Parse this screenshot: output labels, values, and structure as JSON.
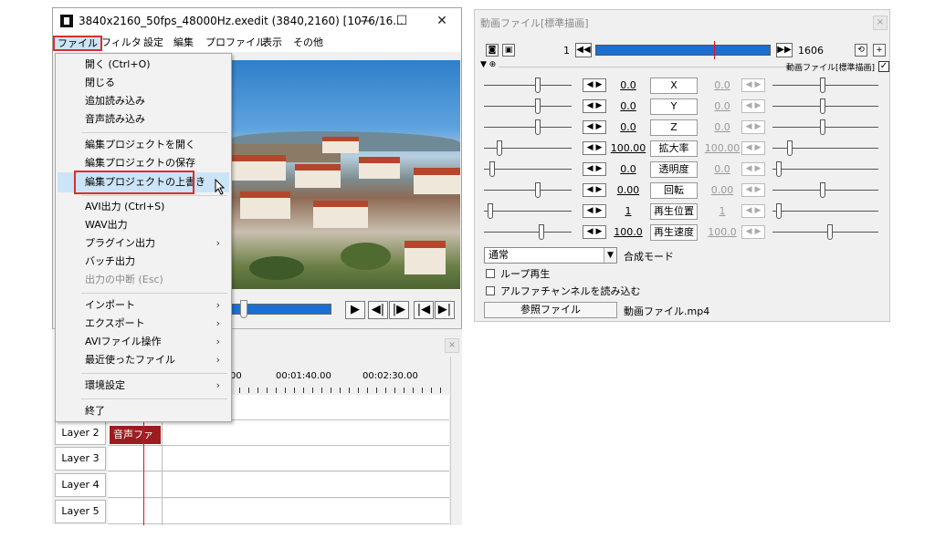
{
  "main_window": {
    "title": "3840x2160_50fps_48000Hz.exedit (3840,2160)  [1076/16...",
    "controls": {
      "minimize": "—",
      "maximize": "☐",
      "close": "✕"
    },
    "menubar": [
      "ファイル",
      "フィルタ",
      "設定",
      "編集",
      "プロファイル",
      "表示",
      "その他"
    ]
  },
  "file_menu": {
    "items": [
      {
        "label": "開く (Ctrl+O)"
      },
      {
        "label": "閉じる"
      },
      {
        "label": "追加読み込み"
      },
      {
        "label": "音声読み込み"
      },
      {
        "label": "編集プロジェクトを開く"
      },
      {
        "label": "編集プロジェクトの保存"
      },
      {
        "label": "編集プロジェクトの上書き"
      },
      {
        "label": "AVI出力 (Ctrl+S)"
      },
      {
        "label": "WAV出力"
      },
      {
        "label": "プラグイン出力",
        "arrow": "›"
      },
      {
        "label": "バッチ出力"
      },
      {
        "label": "出力の中断 (Esc)"
      },
      {
        "label": "インポート",
        "arrow": "›"
      },
      {
        "label": "エクスポート",
        "arrow": "›"
      },
      {
        "label": "AVIファイル操作",
        "arrow": "›"
      },
      {
        "label": "最近使ったファイル",
        "arrow": "›"
      },
      {
        "label": "環境設定",
        "arrow": "›"
      },
      {
        "label": "終了"
      }
    ],
    "highlighted_item": "編集プロジェクトの上書き"
  },
  "transport": {
    "buttons": [
      "▶",
      "◀|",
      "|▶",
      "|◀",
      "▶|"
    ]
  },
  "timeline": {
    "close": "×",
    "ruler_labels": [
      "00",
      "00:01:40.00",
      "00:02:30.00"
    ],
    "layers": [
      "Layer 2",
      "Layer 3",
      "Layer 4",
      "Layer 5"
    ],
    "clip_label": "音声ファイル"
  },
  "dialog": {
    "title": "動画ファイル[標準描画]",
    "close": "×",
    "frame_start": "1",
    "frame_end": "1606",
    "frame_left_btn": "◀◀",
    "frame_right_btn": "▶▶",
    "top_icons": [
      "◙",
      "▣"
    ],
    "right_icons": [
      "⟲",
      "+"
    ],
    "object_label": "動画ファイル[標準描画]",
    "object_checked": "✓",
    "params": [
      {
        "name": "X",
        "left_value": "0.0",
        "right_value": "0.0",
        "right_active": false
      },
      {
        "name": "Y",
        "left_value": "0.0",
        "right_value": "0.0",
        "right_active": false
      },
      {
        "name": "Z",
        "left_value": "0.0",
        "right_value": "0.0",
        "right_active": false
      },
      {
        "name": "拡大率",
        "left_value": "100.00",
        "right_value": "100.00",
        "right_active": false
      },
      {
        "name": "透明度",
        "left_value": "0.0",
        "right_value": "0.0",
        "right_active": false
      },
      {
        "name": "回転",
        "left_value": "0.00",
        "right_value": "0.00",
        "right_active": false
      },
      {
        "name": "再生位置",
        "left_value": "1",
        "right_value": "1",
        "right_active": false
      },
      {
        "name": "再生速度",
        "left_value": "100.0",
        "right_value": "100.0",
        "right_active": false
      }
    ],
    "lr_glyphs": {
      "left": "◀",
      "right": "▶"
    },
    "blend_mode": "通常",
    "blend_arrow": "▼",
    "blend_label": "合成モード",
    "loop_label": "ループ再生",
    "alpha_label": "アルファチャンネルを読み込む",
    "ref_button": "参照ファイル",
    "ref_file": "動画ファイル.mp4"
  },
  "colors": {
    "highlight_red": "#d9302a",
    "selection_blue": "#cce4f7",
    "track_blue": "#1c6fd1",
    "clip_red": "#9b1d20"
  }
}
